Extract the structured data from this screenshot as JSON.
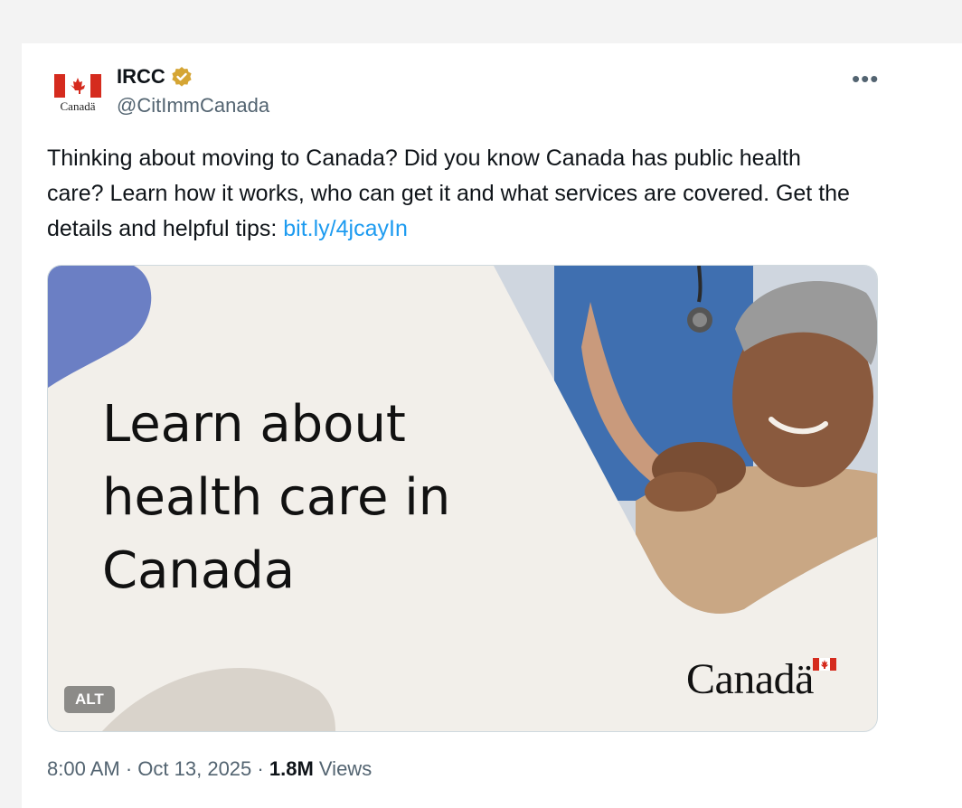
{
  "account": {
    "name": "IRCC",
    "handle": "@CitImmCanada",
    "avatar_caption": "Canadä",
    "verified": true,
    "verified_color": "#d5a534"
  },
  "more_label": "•••",
  "tweet": {
    "text_before_link": "Thinking about moving to Canada? Did you know Canada has public health care? Learn how it works, who can get it and what services are covered. Get the details and helpful tips: ",
    "link_text": "bit.ly/4jcayIn",
    "link_color": "#1d9bf0"
  },
  "media": {
    "headline_lines": [
      "Learn about",
      "health care in",
      "Canada"
    ],
    "wordmark": "Canadä",
    "alt_badge": "ALT",
    "accent_color": "#6b7fc4",
    "background_color": "#f2efea"
  },
  "meta": {
    "time": "8:00 AM",
    "date": "Oct 13, 2025",
    "views_count": "1.8M",
    "views_label": "Views"
  },
  "icons": [
    "canada-flag-icon",
    "verified-badge-icon",
    "more-icon",
    "stethoscope-icon"
  ]
}
